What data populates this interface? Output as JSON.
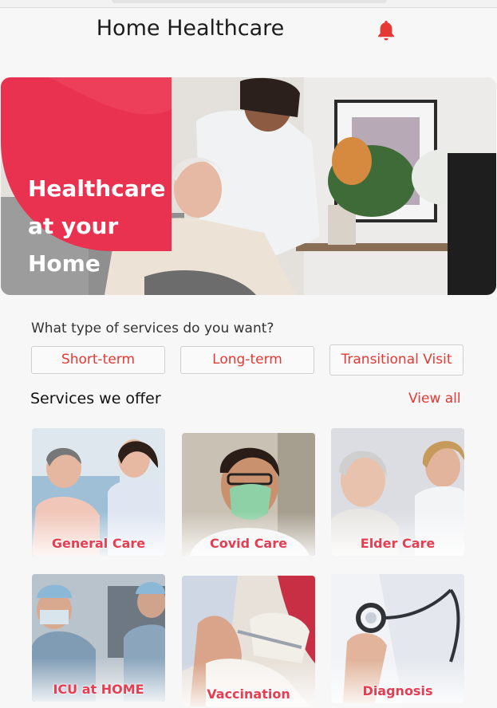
{
  "header": {
    "title": "Home Healthcare",
    "notification_icon": "bell-icon",
    "accent": "#e53935"
  },
  "hero": {
    "lines": [
      "Healthcare",
      "at your",
      "Home"
    ],
    "badge_color": "#e8324f"
  },
  "services": {
    "question": "What type of services do you want?",
    "options": [
      "Short-term",
      "Long-term",
      "Transitional Visit"
    ]
  },
  "offer": {
    "title": "Services we offer",
    "view_all": "View all",
    "cards": [
      "General Care",
      "Covid Care",
      "Elder Care",
      "ICU at HOME",
      "Vaccination",
      "Diagnosis"
    ]
  }
}
